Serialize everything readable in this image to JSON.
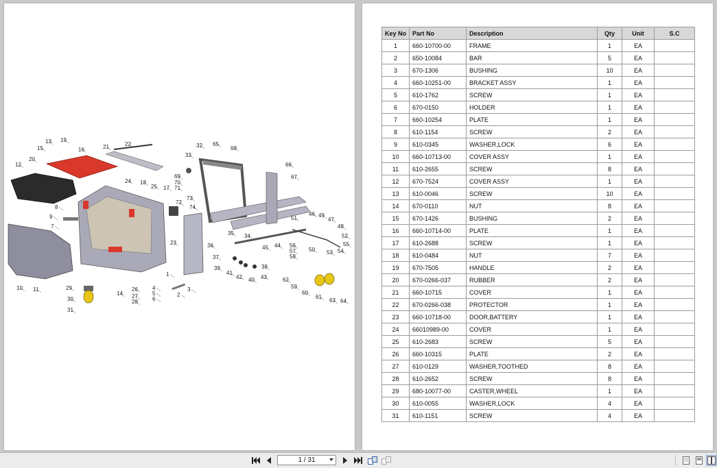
{
  "toolbar": {
    "page_indicator": "1 / 31"
  },
  "icons": {
    "first": "skip-to-first-icon",
    "prev": "previous-page-icon",
    "next": "next-page-icon",
    "last": "skip-to-last-icon",
    "rotate_a": "rotate-view-icon",
    "rotate_b": "rotate-view-alt-icon",
    "single": "single-page-view-icon",
    "two_page": "two-page-view-icon",
    "continuous": "two-page-continuous-view-icon"
  },
  "colors": {
    "background": "#c9c9c9",
    "red_part": "#d9382b",
    "caster_yellow": "#e8c61a",
    "header_fill": "#d8d8d8"
  },
  "diagram": {
    "callouts": [
      "1",
      "2",
      "3",
      "4",
      "5",
      "6",
      "7",
      "8",
      "9",
      "10",
      "11",
      "12",
      "13",
      "14",
      "15",
      "16",
      "17",
      "18",
      "19",
      "20",
      "21",
      "22",
      "23",
      "24",
      "25",
      "26",
      "27",
      "28",
      "29",
      "30",
      "31",
      "32",
      "33",
      "34",
      "35",
      "36",
      "37",
      "38",
      "39",
      "40",
      "41",
      "42",
      "43",
      "44",
      "45",
      "46",
      "47",
      "48",
      "49",
      "50",
      "51",
      "52",
      "53",
      "54",
      "55",
      "56",
      "57",
      "58",
      "59",
      "60",
      "61",
      "62",
      "63",
      "64",
      "65",
      "66",
      "67",
      "68",
      "69",
      "70",
      "71",
      "72",
      "73",
      "74"
    ]
  },
  "table": {
    "headers": [
      "Key No",
      "Part No",
      "Description",
      "Qty",
      "Unit",
      "S.C"
    ],
    "rows": [
      [
        "1",
        "660-10700-00",
        "FRAME",
        "1",
        "EA",
        ""
      ],
      [
        "2",
        "650-10084",
        "BAR",
        "5",
        "EA",
        ""
      ],
      [
        "3",
        "670-1306",
        "BUSHING",
        "10",
        "EA",
        ""
      ],
      [
        "4",
        "660-10251-00",
        "BRACKET ASSY",
        "1",
        "EA",
        ""
      ],
      [
        "5",
        "610-1762",
        "SCREW",
        "1",
        "EA",
        ""
      ],
      [
        "6",
        "670-0150",
        "HOLDER",
        "1",
        "EA",
        ""
      ],
      [
        "7",
        "660-10254",
        "PLATE",
        "1",
        "EA",
        ""
      ],
      [
        "8",
        "610-1154",
        "SCREW",
        "2",
        "EA",
        ""
      ],
      [
        "9",
        "610-0345",
        "WASHER,LOCK",
        "6",
        "EA",
        ""
      ],
      [
        "10",
        "660-10713-00",
        "COVER ASSY",
        "1",
        "EA",
        ""
      ],
      [
        "11",
        "610-2655",
        "SCREW",
        "8",
        "EA",
        ""
      ],
      [
        "12",
        "670-7524",
        "COVER ASSY",
        "1",
        "EA",
        ""
      ],
      [
        "13",
        "610-0046",
        "SCREW",
        "10",
        "EA",
        ""
      ],
      [
        "14",
        "670-0110",
        "NUT",
        "8",
        "EA",
        ""
      ],
      [
        "15",
        "670-1426",
        "BUSHING",
        "2",
        "EA",
        ""
      ],
      [
        "16",
        "660-10714-00",
        "PLATE",
        "1",
        "EA",
        ""
      ],
      [
        "17",
        "610-2688",
        "SCREW",
        "1",
        "EA",
        ""
      ],
      [
        "18",
        "610-0484",
        "NUT",
        "7",
        "EA",
        ""
      ],
      [
        "19",
        "670-7505",
        "HANDLE",
        "2",
        "EA",
        ""
      ],
      [
        "20",
        "670-0266-037",
        "RUBBER",
        "2",
        "EA",
        ""
      ],
      [
        "21",
        "660-10715",
        "COVER",
        "1",
        "EA",
        ""
      ],
      [
        "22",
        "670-0266-038",
        "PROTECTOR",
        "1",
        "EA",
        ""
      ],
      [
        "23",
        "660-10718-00",
        "DOOR,BATTERY",
        "1",
        "EA",
        ""
      ],
      [
        "24",
        "66010989-00",
        "COVER",
        "1",
        "EA",
        ""
      ],
      [
        "25",
        "610-2683",
        "SCREW",
        "5",
        "EA",
        ""
      ],
      [
        "26",
        "660-10315",
        "PLATE",
        "2",
        "EA",
        ""
      ],
      [
        "27",
        "610-0129",
        "WASHER,TOOTHED",
        "8",
        "EA",
        ""
      ],
      [
        "28",
        "610-2652",
        "SCREW",
        "8",
        "EA",
        ""
      ],
      [
        "29",
        "680-10077-00",
        "CASTER,WHEEL",
        "1",
        "EA",
        ""
      ],
      [
        "30",
        "610-0055",
        "WASHER,LOCK",
        "4",
        "EA",
        ""
      ],
      [
        "31",
        "610-1151",
        "SCREW",
        "4",
        "EA",
        ""
      ]
    ]
  }
}
